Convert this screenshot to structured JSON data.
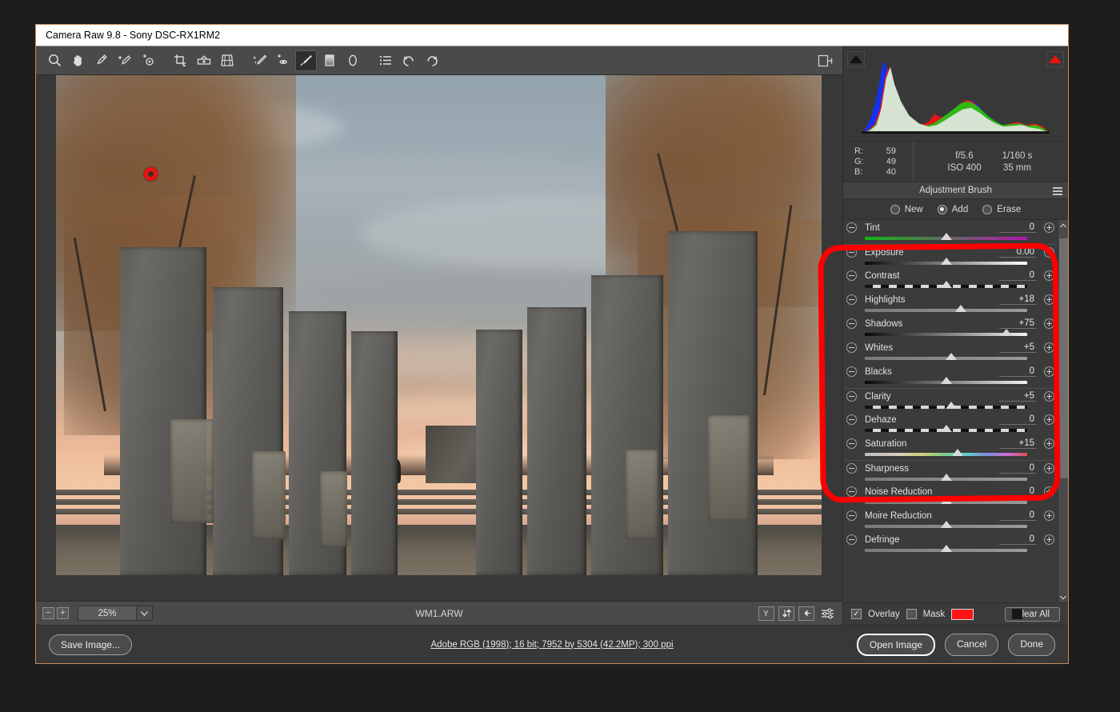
{
  "window": {
    "title": "Camera Raw 9.8  -  Sony DSC-RX1RM2"
  },
  "toolbar": {
    "tools": [
      {
        "name": "zoom-tool",
        "label": "Zoom Tool",
        "active": false
      },
      {
        "name": "hand-tool",
        "label": "Hand Tool",
        "active": false
      },
      {
        "name": "white-balance-tool",
        "label": "White Balance Tool",
        "active": false
      },
      {
        "name": "color-sampler-tool",
        "label": "Color Sampler Tool",
        "active": false
      },
      {
        "name": "targeted-adjustment-tool",
        "label": "Targeted Adjustment Tool",
        "active": false
      },
      {
        "name": "crop-tool",
        "label": "Crop Tool",
        "active": false
      },
      {
        "name": "straighten-tool",
        "label": "Straighten Tool",
        "active": false
      },
      {
        "name": "transform-tool",
        "label": "Transform Tool",
        "active": false
      },
      {
        "name": "spot-removal-tool",
        "label": "Spot Removal",
        "active": false
      },
      {
        "name": "red-eye-removal-tool",
        "label": "Red Eye Removal",
        "active": false
      },
      {
        "name": "adjustment-brush-tool",
        "label": "Adjustment Brush",
        "active": true
      },
      {
        "name": "graduated-filter-tool",
        "label": "Graduated Filter",
        "active": false
      },
      {
        "name": "radial-filter-tool",
        "label": "Radial Filter",
        "active": false
      },
      {
        "name": "presets-tool",
        "label": "Presets",
        "active": false
      },
      {
        "name": "rotate-counterclockwise-tool",
        "label": "Rotate Image Counterclockwise",
        "active": false
      },
      {
        "name": "rotate-clockwise-tool",
        "label": "Rotate Image Clockwise",
        "active": false
      }
    ],
    "panel_toggle_label": "Toggle Filmstrip"
  },
  "histogram": {
    "shadow_clipping_color": "#111111",
    "highlight_clipping_color": "#ee1111"
  },
  "readout": {
    "rgb": [
      {
        "channel": "R:",
        "value": "59"
      },
      {
        "channel": "G:",
        "value": "49"
      },
      {
        "channel": "B:",
        "value": "40"
      }
    ],
    "exif_row1": [
      "f/5.6",
      "1/160 s"
    ],
    "exif_row2": [
      "ISO 400",
      "35 mm"
    ]
  },
  "panel": {
    "title": "Adjustment Brush",
    "modes": [
      {
        "label": "New",
        "selected": false
      },
      {
        "label": "Add",
        "selected": true
      },
      {
        "label": "Erase",
        "selected": false
      }
    ],
    "sliders": [
      {
        "name": "tint",
        "label": "Tint",
        "value": "0",
        "pos": 50,
        "track": "tint",
        "sep": false
      },
      {
        "name": "exposure",
        "label": "Exposure",
        "value": "0.00",
        "pos": 50,
        "track": "bw",
        "sep": true
      },
      {
        "name": "contrast",
        "label": "Contrast",
        "value": "0",
        "pos": 50,
        "track": "contrast",
        "sep": false
      },
      {
        "name": "highlights",
        "label": "Highlights",
        "value": "+18",
        "pos": 59,
        "track": "plain",
        "sep": false
      },
      {
        "name": "shadows",
        "label": "Shadows",
        "value": "+75",
        "pos": 87,
        "track": "shadows",
        "sep": false
      },
      {
        "name": "whites",
        "label": "Whites",
        "value": "+5",
        "pos": 53,
        "track": "plain",
        "sep": false
      },
      {
        "name": "blacks",
        "label": "Blacks",
        "value": "0",
        "pos": 50,
        "track": "shadows",
        "sep": false
      },
      {
        "name": "clarity",
        "label": "Clarity",
        "value": "+5",
        "pos": 53,
        "track": "contrast",
        "sep": true
      },
      {
        "name": "dehaze",
        "label": "Dehaze",
        "value": "0",
        "pos": 50,
        "track": "contrast",
        "sep": false
      },
      {
        "name": "saturation",
        "label": "Saturation",
        "value": "+15",
        "pos": 57,
        "track": "sat",
        "sep": false
      },
      {
        "name": "sharpness",
        "label": "Sharpness",
        "value": "0",
        "pos": 50,
        "track": "plain",
        "sep": true
      },
      {
        "name": "noise-reduction",
        "label": "Noise Reduction",
        "value": "0",
        "pos": 50,
        "track": "plain",
        "sep": false
      },
      {
        "name": "moire-reduction",
        "label": "Moire Reduction",
        "value": "0",
        "pos": 50,
        "track": "plain",
        "sep": false
      },
      {
        "name": "defringe",
        "label": "Defringe",
        "value": "0",
        "pos": 50,
        "track": "plain",
        "sep": false
      }
    ],
    "overlay": {
      "label": "Overlay",
      "checked": true,
      "check_glyph": "✓"
    },
    "mask": {
      "label": "Mask",
      "checked": false,
      "color": "#ff1414"
    },
    "clear_all_label": "Clear All"
  },
  "imagebar": {
    "zoom_out_label": "−",
    "zoom_in_label": "+",
    "zoom_value": "25%",
    "filename": "WM1.ARW",
    "icons": [
      {
        "name": "rotate-preview-icon",
        "glyph": "Y"
      },
      {
        "name": "sync-settings-icon",
        "glyph": "⇅"
      },
      {
        "name": "rotate-left-icon",
        "glyph": "←"
      },
      {
        "name": "preferences-icon",
        "glyph": "☰"
      }
    ]
  },
  "footer": {
    "save_image_label": "Save Image...",
    "workflow_options": "Adobe RGB (1998); 16 bit; 7952 by 5304 (42.2MP); 300 ppi",
    "open_image_label": "Open Image",
    "cancel_label": "Cancel",
    "done_label": "Done"
  },
  "annotation": {
    "name": "red-highlight-circle",
    "color": "#ff0000",
    "targets": "Exposure through Saturation sliders"
  },
  "photo": {
    "pin_label": "adjustment-brush-pin",
    "description": "Stone memorial colonnade at sunset"
  }
}
